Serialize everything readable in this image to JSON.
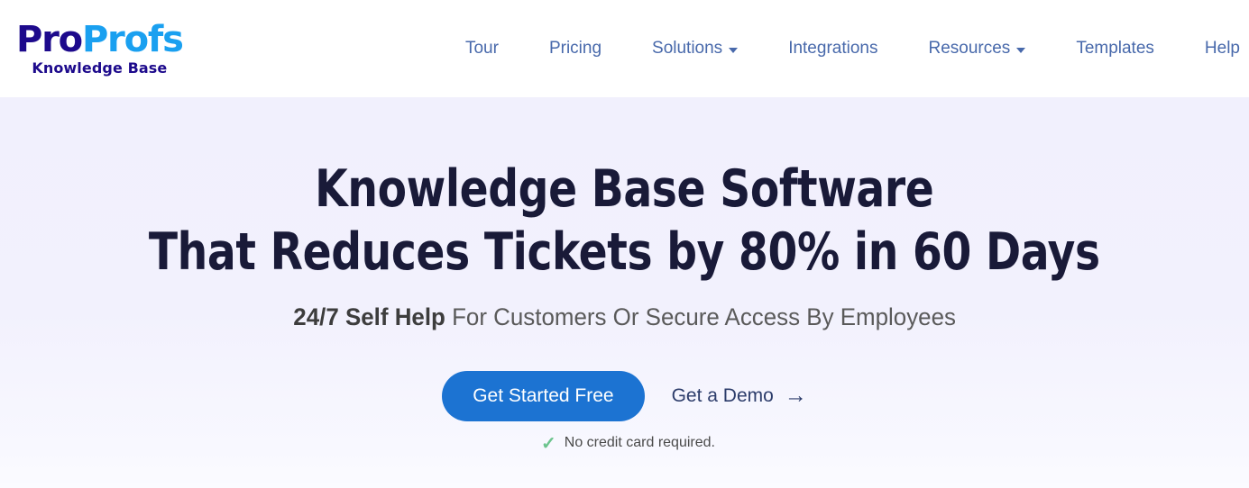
{
  "header": {
    "logo": {
      "word_primary": "Pro",
      "word_secondary": "Profs",
      "subtitle": "Knowledge Base",
      "color_primary": "#1d0a8c",
      "color_secondary": "#1aa0f0"
    },
    "nav": [
      {
        "label": "Tour",
        "has_dropdown": false
      },
      {
        "label": "Pricing",
        "has_dropdown": false
      },
      {
        "label": "Solutions",
        "has_dropdown": true
      },
      {
        "label": "Integrations",
        "has_dropdown": false
      },
      {
        "label": "Resources",
        "has_dropdown": true
      },
      {
        "label": "Templates",
        "has_dropdown": false
      },
      {
        "label": "Help",
        "has_dropdown": false
      }
    ],
    "nav_color": "#4869ab",
    "background": "#ffffff"
  },
  "hero": {
    "title_line1": "Knowledge Base Software",
    "title_line2": "That Reduces Tickets by 80% in 60 Days",
    "title_color": "#191a38",
    "subtitle_bold": "24/7 Self Help",
    "subtitle_rest": " For Customers Or Secure Access By Employees",
    "subtitle_color": "#5a5a5a",
    "primary_cta": "Get Started Free",
    "primary_cta_color": "#1c73d2",
    "secondary_cta": "Get a Demo",
    "secondary_cta_arrow": "→",
    "note_icon": "✓",
    "note_icon_color": "#6cc48e",
    "note_text": "No credit card required.",
    "background": "#f1f0fd"
  }
}
